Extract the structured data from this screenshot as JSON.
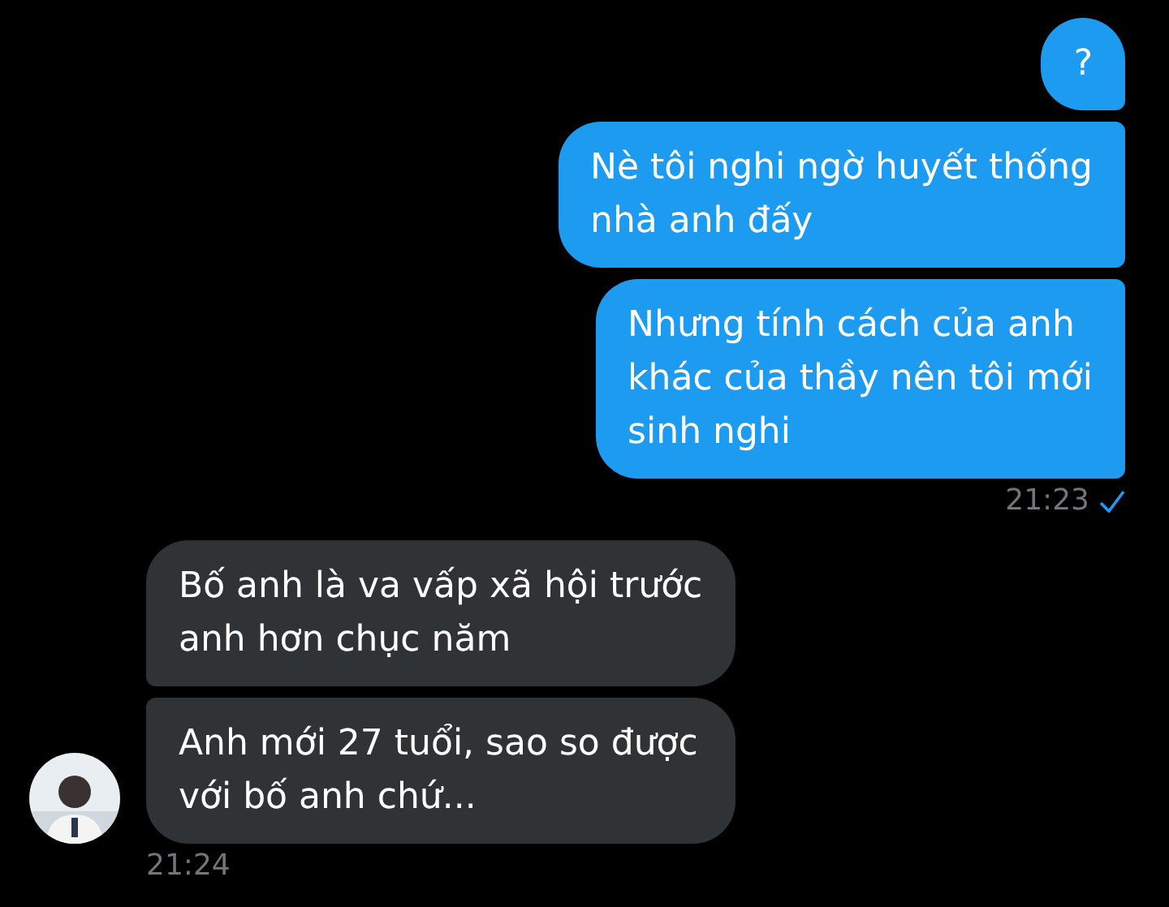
{
  "groups": [
    {
      "kind": "sent",
      "messages": [
        {
          "text": "?"
        },
        {
          "text": "Nè tôi nghi ngờ huyết thống\nnhà anh đấy"
        },
        {
          "text": "Nhưng tính cách của anh\nkhác của thầy nên tôi mới\nsinh nghi"
        }
      ],
      "time": "21:23",
      "read": true
    },
    {
      "kind": "received",
      "messages": [
        {
          "text": "Bố anh là va vấp xã hội trước\nanh hơn chục năm"
        },
        {
          "text": "Anh mới 27 tuổi, sao so được\nvới bố anh chứ..."
        }
      ],
      "time": "21:24"
    }
  ]
}
